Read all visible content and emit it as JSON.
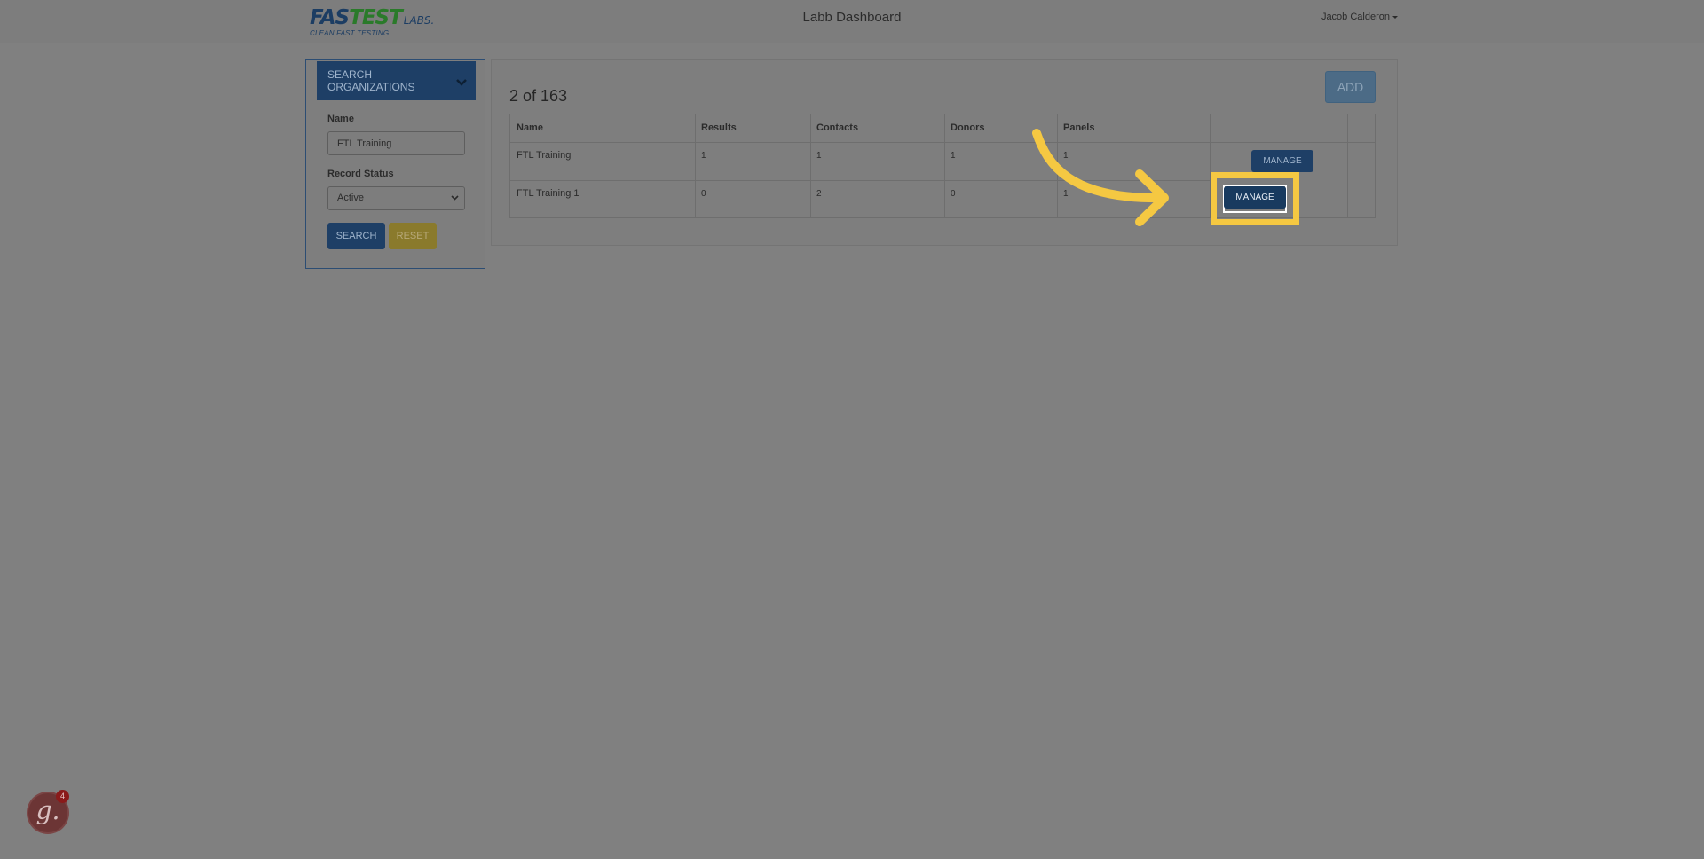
{
  "header": {
    "logo": {
      "brand_a": "FAS",
      "brand_b": "TEST",
      "brand_c": "LABS.",
      "tagline": "CLEAN FAST TESTING"
    },
    "app_title": "Labb Dashboard",
    "user_name": "Jacob Calderon"
  },
  "search": {
    "title": "SEARCH ORGANIZATIONS",
    "name_label": "Name",
    "name_value": "FTL Training",
    "status_label": "Record Status",
    "status_value": "Active",
    "search_button": "SEARCH",
    "reset_button": "RESET"
  },
  "results": {
    "count_text": "2 of 163",
    "add_button": "ADD",
    "columns": [
      "Name",
      "Results",
      "Contacts",
      "Donors",
      "Panels"
    ],
    "rows": [
      {
        "name": "FTL Training",
        "results": "1",
        "contacts": "1",
        "donors": "1",
        "panels": "1",
        "action": "MANAGE"
      },
      {
        "name": "FTL Training 1",
        "results": "0",
        "contacts": "2",
        "donors": "0",
        "panels": "1",
        "action": "MANAGE"
      }
    ]
  },
  "guide_badge": {
    "letter": "g.",
    "count": "4"
  },
  "colors": {
    "highlight": "#f5c842",
    "primary": "#1e3f66",
    "reset": "#8a7a2c",
    "add": "#4c6b86"
  },
  "icons": [
    "chevron-down-icon",
    "caret-down-icon",
    "curved-arrow-icon"
  ]
}
